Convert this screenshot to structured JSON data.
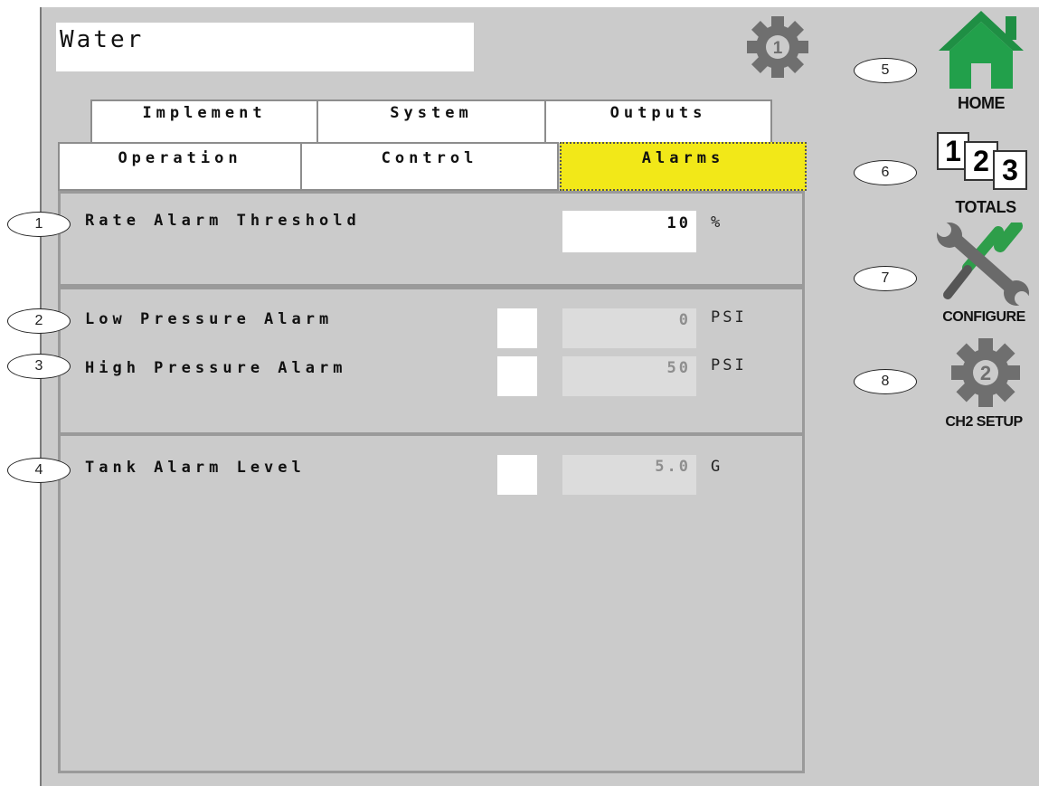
{
  "title": "Water",
  "header_badge_number": "1",
  "tabs_row1": [
    {
      "label": "Implement"
    },
    {
      "label": "System"
    },
    {
      "label": "Outputs"
    }
  ],
  "tabs_row2": [
    {
      "label": "Operation"
    },
    {
      "label": "Control"
    },
    {
      "label": "Alarms",
      "active": true
    }
  ],
  "rate_alarm": {
    "label": "Rate Alarm Threshold",
    "value": "10",
    "unit": "%",
    "callout": "1"
  },
  "low_pressure": {
    "label": "Low Pressure Alarm",
    "value": "0",
    "unit": "PSI",
    "callout": "2"
  },
  "high_pressure": {
    "label": "High Pressure Alarm",
    "value": "50",
    "unit": "PSI",
    "callout": "3"
  },
  "tank_alarm": {
    "label": "Tank Alarm Level",
    "value": "5.0",
    "unit": "G",
    "callout": "4"
  },
  "side_nav": [
    {
      "label": "HOME",
      "callout": "5",
      "icon": "home-icon"
    },
    {
      "label": "TOTALS",
      "callout": "6",
      "icon": "totals-icon"
    },
    {
      "label": "CONFIGURE",
      "callout": "7",
      "icon": "wrench-screwdriver-icon"
    },
    {
      "label": "CH2 SETUP",
      "callout": "8",
      "icon": "gear-2-icon"
    }
  ],
  "totals_icon_digits": [
    "1",
    "2",
    "3"
  ],
  "ch2_badge_number": "2",
  "colors": {
    "background": "#cbcbcb",
    "active_tab": "#f2e818",
    "home_green": "#22a04b",
    "gear_gray": "#6f6f6f",
    "configure_green": "#2e9e4a"
  }
}
